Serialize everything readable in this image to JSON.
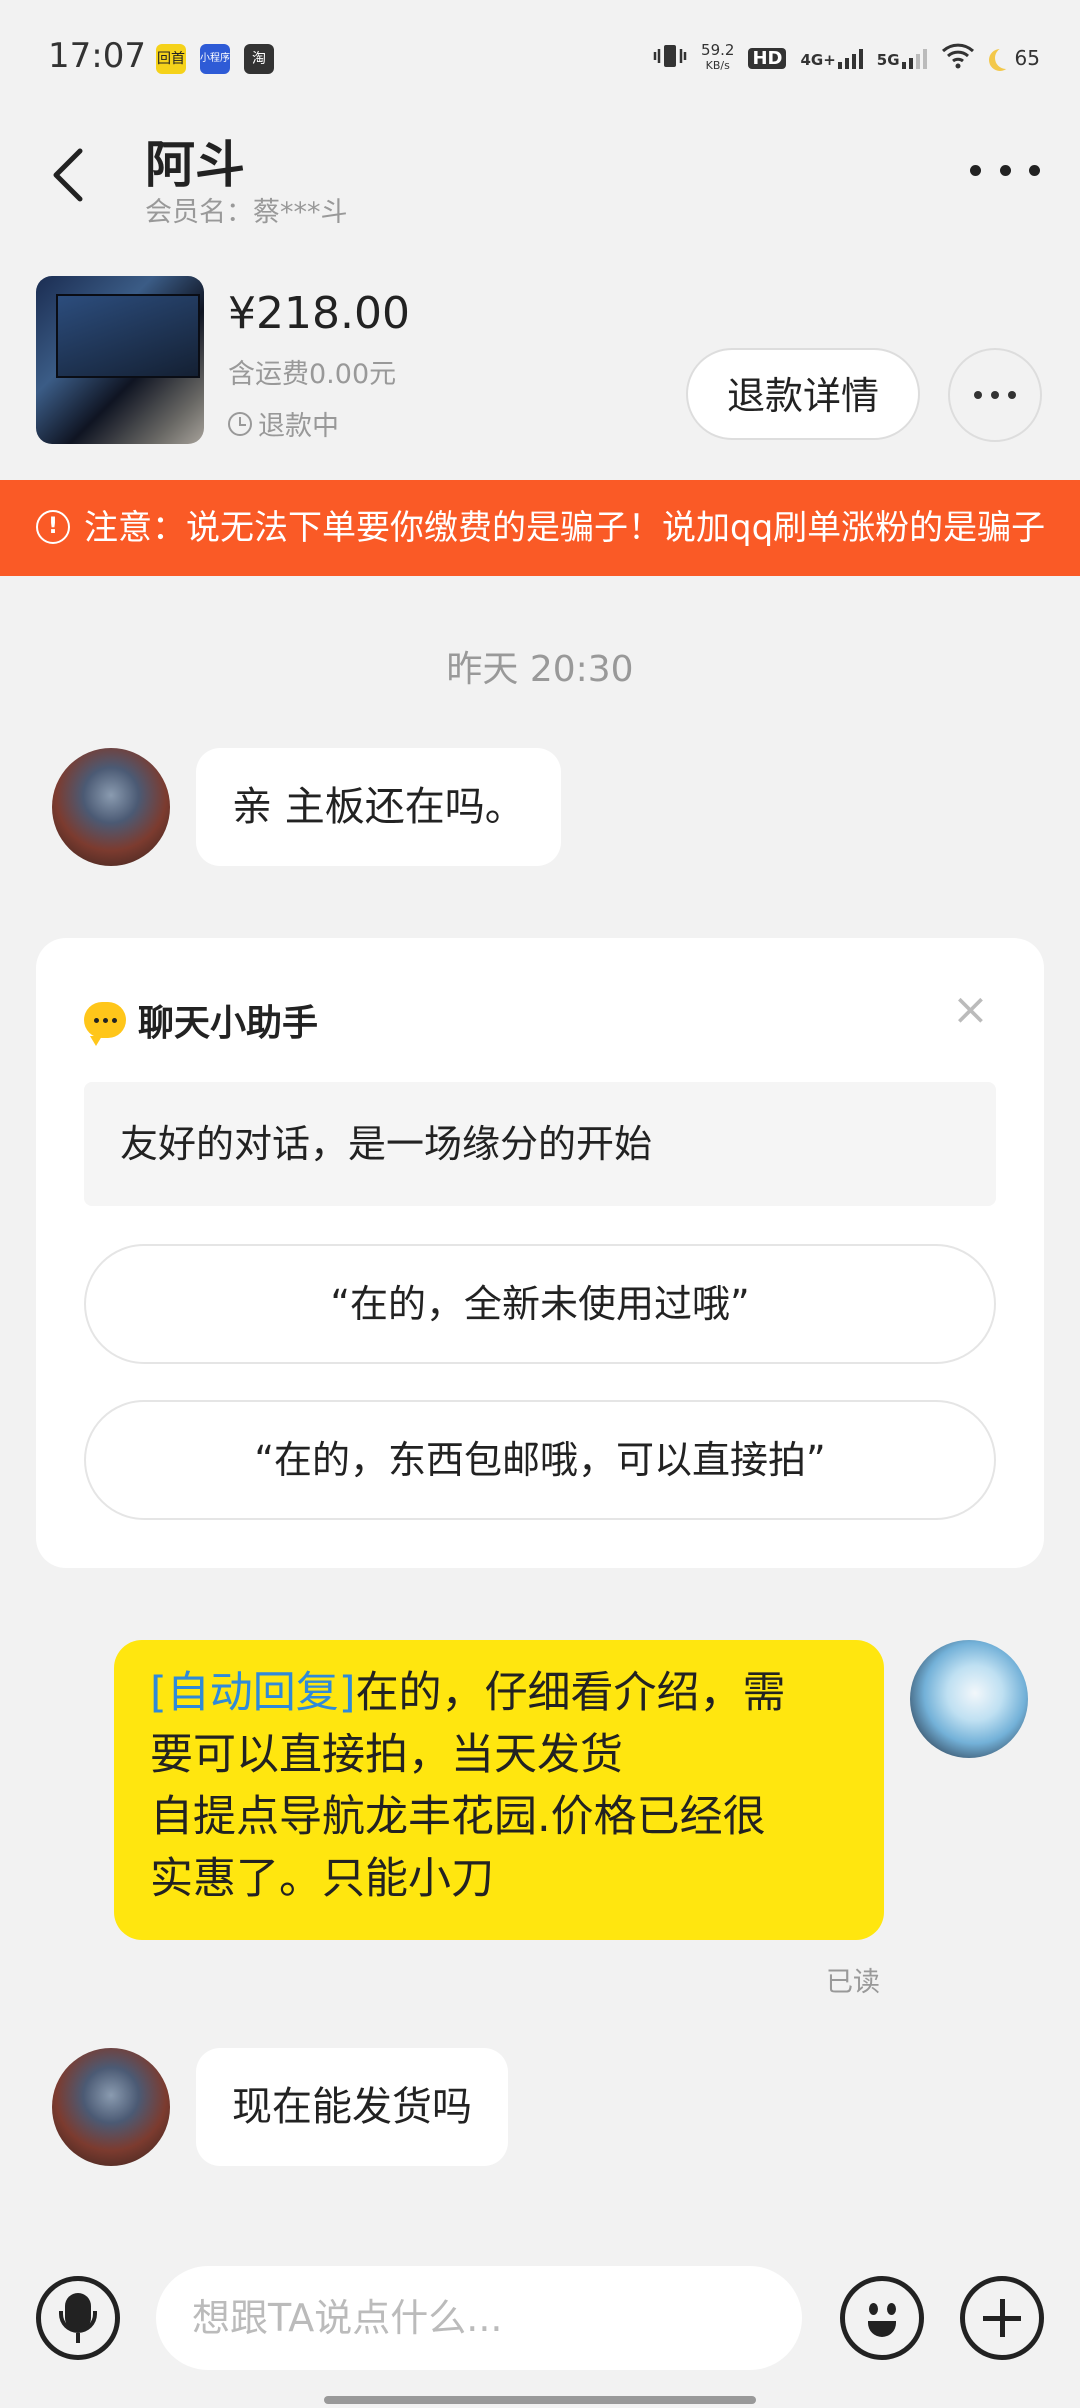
{
  "status_bar": {
    "time": "17:07",
    "speed_value": "59.2",
    "speed_unit": "KB/s",
    "hd": "HD",
    "net1": "4G+",
    "net2": "5G",
    "battery": "65",
    "mini_apps": [
      "回首",
      "小程序",
      "淘"
    ]
  },
  "header": {
    "title": "阿斗",
    "subtitle": "会员名：蔡***斗"
  },
  "product": {
    "price": "¥218.00",
    "shipping": "含运费0.00元",
    "status": "退款中",
    "refund_button": "退款详情"
  },
  "warning": {
    "icon": "!",
    "text": "注意：说无法下单要你缴费的是骗子！说加qq刷单涨粉的是骗子"
  },
  "chat": {
    "time_label": "昨天 20:30",
    "msg1": "亲 主板还在吗。",
    "assistant": {
      "title": "聊天小助手",
      "close": "×",
      "tip": "友好的对话，是一场缘分的开始",
      "suggestions": [
        "“在的，全新未使用过哦”",
        "“在的，东西包邮哦，可以直接拍”"
      ]
    },
    "reply": {
      "tag": "[自动回复]",
      "line1": "在的，仔细看介绍，需",
      "line2": "要可以直接拍，当天发货",
      "line3": "自提点导航龙丰花园.价格已经很",
      "line4": "实惠了。只能小刀"
    },
    "read": "已读",
    "msg2": "现在能发货吗"
  },
  "input": {
    "placeholder": "想跟TA说点什么..."
  }
}
